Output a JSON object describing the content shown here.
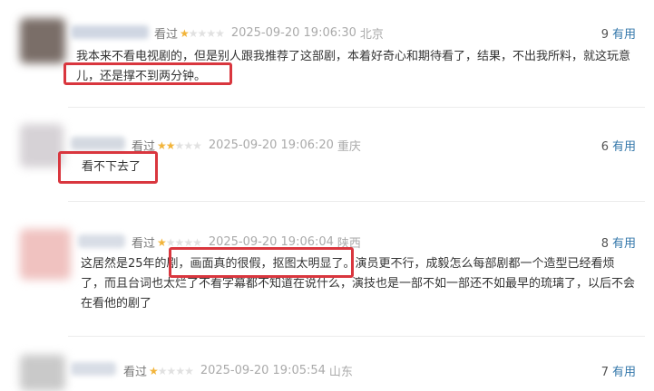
{
  "reviews": [
    {
      "watched": "看过",
      "rating": 1,
      "time": "2025-09-20 19:06:30",
      "location": "北京",
      "useful_count": "9",
      "useful_label": "有用",
      "lines": [
        "我本来不看电视剧的，但是别人跟我推荐了这部剧，本着好奇心和期待看了，结果，不出我所料，就这玩意",
        "儿，还是撑不到两分钟。"
      ]
    },
    {
      "watched": "看过",
      "rating": 2,
      "time": "2025-09-20 19:06:20",
      "location": "重庆",
      "useful_count": "6",
      "useful_label": "有用",
      "lines": [
        "看不下去了"
      ]
    },
    {
      "watched": "看过",
      "rating": 1,
      "time": "2025-09-20 19:06:04",
      "location": "陕西",
      "useful_count": "8",
      "useful_label": "有用",
      "lines": [
        "这居然是25年的剧，画面真的很假，抠图太明显了。演员更不行，成毅怎么每部剧都一个造型已经看烦",
        "了，而且台词也太烂了不看字幕都不知道在说什么，演技也是一部不如一部还不如最早的琉璃了，以后不会",
        "在看他的剧了"
      ]
    },
    {
      "watched": "看过",
      "rating": 1,
      "time": "2025-09-20 19:05:54",
      "location": "山东",
      "useful_count": "7",
      "useful_label": "有用",
      "lines": []
    }
  ],
  "colors": {
    "star_on": "#f2b43a",
    "star_off": "#e1e1e1",
    "useful_link": "#3377aa",
    "highlight": "#d9363e"
  }
}
